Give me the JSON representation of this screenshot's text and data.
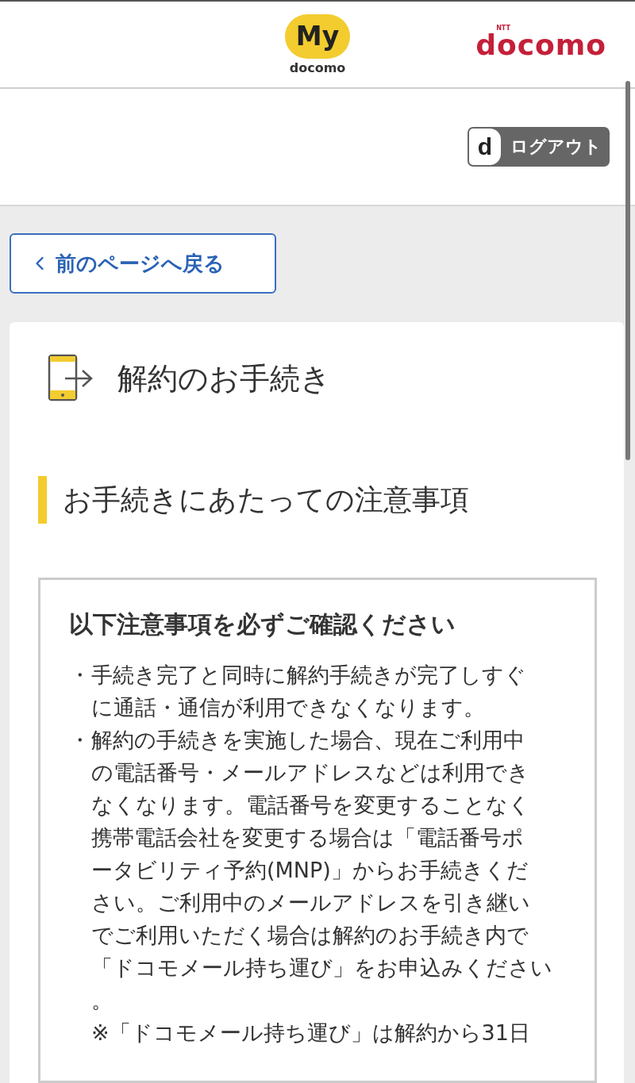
{
  "header": {
    "app_logo": {
      "mark": "My",
      "sub": "docomo"
    },
    "brand_logo": {
      "small": "NTT",
      "name": "docomo"
    }
  },
  "logout_button": {
    "badge": "d",
    "label": "ログアウト"
  },
  "back_button": "前のページへ戻る",
  "page_title": "解約のお手続き",
  "section_heading": "お手続きにあたっての注意事項",
  "notice": {
    "heading": "以下注意事項を必ずご確認ください",
    "items": [
      {
        "kind": "bullet",
        "marker": "・",
        "lines": [
          "手続き完了と同時に解約手続きが完了しすぐ",
          "に通話・通信が利用できなくなります。"
        ]
      },
      {
        "kind": "bullet",
        "marker": "・",
        "lines": [
          "解約の手続きを実施した場合、現在ご利用中",
          "の電話番号・メールアドレスなどは利用でき",
          "なくなります。電話番号を変更することなく",
          "携帯電話会社を変更する場合は「電話番号ポ",
          "ータビリティ予約(MNP)」からお手続きくだ",
          "さい。ご利用中のメールアドレスを引き継い",
          "でご利用いただく場合は解約のお手続き内で",
          "「ドコモメール持ち運び」をお申込みください",
          "。"
        ]
      },
      {
        "kind": "note",
        "lines": [
          "※「ドコモメール持ち運び」は解約から31日"
        ]
      }
    ]
  }
}
